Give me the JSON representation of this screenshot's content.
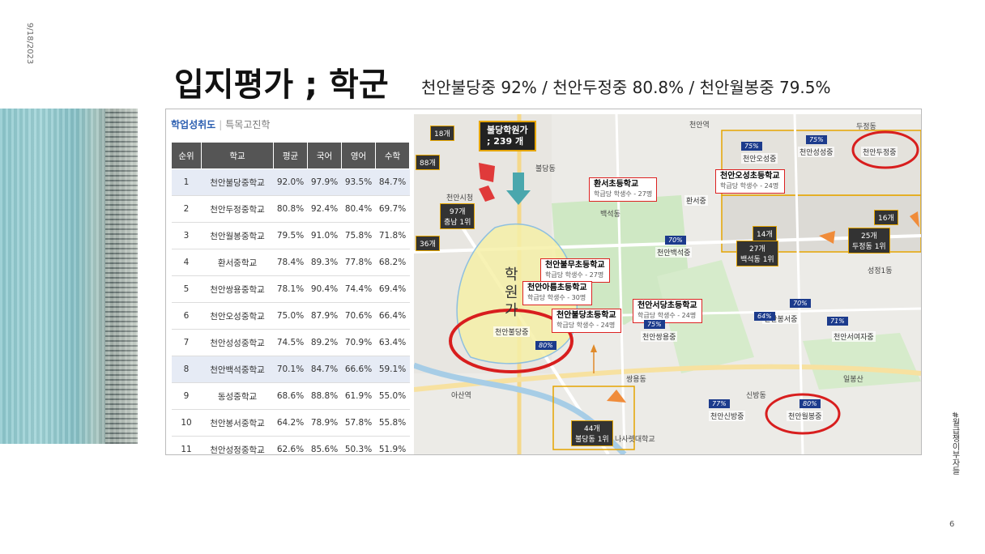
{
  "slide": {
    "date": "9/18/2023",
    "title": "입지평가 ; 학군",
    "subtitle": "천안불당중 92% / 천안두정중 80.8% / 천안월봉중 79.5%",
    "page_number": "6",
    "side_note": "#월급쟁이부자들"
  },
  "tabs": {
    "active": "학업성취도",
    "other": "특목고진학"
  },
  "table": {
    "headers": [
      "순위",
      "학교",
      "평균",
      "국어",
      "영어",
      "수학"
    ],
    "rows": [
      {
        "rank": "1",
        "school": "천안불당중학교",
        "avg": "92.0%",
        "kor": "97.9%",
        "eng": "93.5%",
        "math": "84.7%"
      },
      {
        "rank": "2",
        "school": "천안두정중학교",
        "avg": "80.8%",
        "kor": "92.4%",
        "eng": "80.4%",
        "math": "69.7%"
      },
      {
        "rank": "3",
        "school": "천안월봉중학교",
        "avg": "79.5%",
        "kor": "91.0%",
        "eng": "75.8%",
        "math": "71.8%"
      },
      {
        "rank": "4",
        "school": "환서중학교",
        "avg": "78.4%",
        "kor": "89.3%",
        "eng": "77.8%",
        "math": "68.2%"
      },
      {
        "rank": "5",
        "school": "천안쌍용중학교",
        "avg": "78.1%",
        "kor": "90.4%",
        "eng": "74.4%",
        "math": "69.4%"
      },
      {
        "rank": "6",
        "school": "천안오성중학교",
        "avg": "75.0%",
        "kor": "87.9%",
        "eng": "70.6%",
        "math": "66.4%"
      },
      {
        "rank": "7",
        "school": "천안성성중학교",
        "avg": "74.5%",
        "kor": "89.2%",
        "eng": "70.9%",
        "math": "63.4%"
      },
      {
        "rank": "8",
        "school": "천안백석중학교",
        "avg": "70.1%",
        "kor": "84.7%",
        "eng": "66.6%",
        "math": "59.1%"
      },
      {
        "rank": "9",
        "school": "동성중학교",
        "avg": "68.6%",
        "kor": "88.8%",
        "eng": "61.9%",
        "math": "55.0%"
      },
      {
        "rank": "10",
        "school": "천안봉서중학교",
        "avg": "64.2%",
        "kor": "78.9%",
        "eng": "57.8%",
        "math": "55.8%"
      },
      {
        "rank": "11",
        "school": "천안성정중학교",
        "avg": "62.6%",
        "kor": "85.6%",
        "eng": "50.3%",
        "math": "51.9%"
      }
    ]
  },
  "map": {
    "academy_tag_line1": "불당학원가",
    "academy_tag_line2": "; 239 개",
    "tags": {
      "t18": "18개",
      "t88": "88개",
      "t97": "97개",
      "t97sub": "충남 1위",
      "t36": "36개",
      "t44": "44개",
      "t44sub": "불당동 1위",
      "t14": "14개",
      "t27": "27개",
      "t27sub": "백석동 1위",
      "t25": "25개",
      "t25sub": "두정동 1위",
      "t16": "16개"
    },
    "academy_street": "학원가",
    "elem_schools": [
      {
        "name": "환서초등학교",
        "detail": "학급당 학생수 - 27명"
      },
      {
        "name": "천안오성초등학교",
        "detail": "학급당 학생수 - 24명"
      },
      {
        "name": "천안불무초등학교",
        "detail": "학급당 학생수 - 27명"
      },
      {
        "name": "천안아름초등학교",
        "detail": "학급당 학생수 - 30명"
      },
      {
        "name": "천안불당초등학교",
        "detail": "학급당 학생수 - 24명"
      },
      {
        "name": "천안서당초등학교",
        "detail": "학급당 학생수 - 24명"
      }
    ],
    "mid_schools": {
      "dujeong": "천안두정중",
      "buldang": "천안불당중",
      "wolbong": "천안월봉중",
      "ohseong": "천안오성중",
      "seongseong": "천안성성중",
      "hwanseo": "환서중",
      "baekseok": "천안백석중",
      "seoyeo": "천안서여자중",
      "ssangyong": "천안쌍용중",
      "sinbang": "천안신방중",
      "bongseo": "천안봉서중"
    },
    "pcts": {
      "p1": "75%",
      "p2": "75%",
      "p3": "70%",
      "p4": "80%",
      "p5": "70%",
      "p6": "64%",
      "p7": "71%",
      "p8": "77%",
      "p9": "80%",
      "p10": "75%"
    },
    "labels": {
      "l1": "천안역",
      "l2": "아산역",
      "l3": "일봉산",
      "l4": "나사렛대학교",
      "l5": "천안시청",
      "l6": "불당동",
      "l7": "신방동",
      "l8": "쌍용동",
      "l9": "백석동",
      "l10": "두정동",
      "l11": "성정1동"
    },
    "colors": {
      "highlight_circle": "#d81e1e",
      "academy_zone": "#f6f0a8",
      "flag": "#1c3b8c"
    }
  }
}
